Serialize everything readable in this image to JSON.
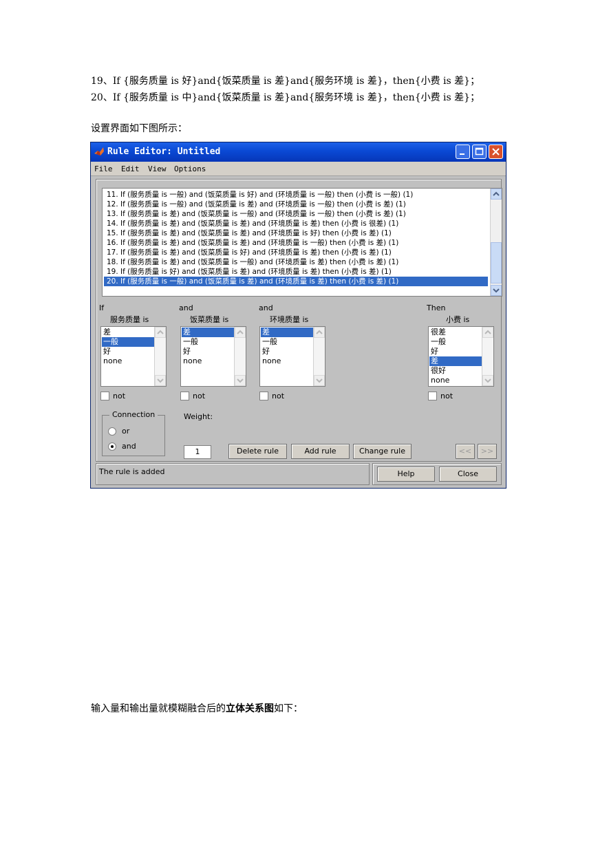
{
  "document": {
    "line1": "19、If {服务质量 is 好}and{饭菜质量 is 差}and{服务环境 is 差}，then{小费 is 差}；",
    "line2": "20、If {服务质量 is 中}and{饭菜质量 is 差}and{服务环境 is 差}，then{小费 is 差}；",
    "intro": "设置界面如下图所示：",
    "outro_prefix": "输入量和输出量就模糊融合后的",
    "outro_bold": "立体关系图",
    "outro_suffix": "如下："
  },
  "window": {
    "title": "Rule Editor: Untitled",
    "menu": [
      "File",
      "Edit",
      "View",
      "Options"
    ]
  },
  "rules": [
    "11. If (服务质量 is 一般) and (饭菜质量 is 好) and (环境质量 is 一般) then (小费 is 一般) (1)",
    "12. If (服务质量 is 一般) and (饭菜质量 is 差) and (环境质量 is 一般) then (小费 is 差) (1)",
    "13. If (服务质量 is 差) and (饭菜质量 is 一般) and (环境质量 is 一般) then (小费 is 差) (1)",
    "14. If (服务质量 is 差) and (饭菜质量 is 差) and (环境质量 is 差) then (小费 is 很差) (1)",
    "15. If (服务质量 is 差) and (饭菜质量 is 差) and (环境质量 is 好) then (小费 is 差) (1)",
    "16. If (服务质量 is 差) and (饭菜质量 is 差) and (环境质量 is 一般) then (小费 is 差) (1)",
    "17. If (服务质量 is 差) and (饭菜质量 is 好) and (环境质量 is 差) then (小费 is 差) (1)",
    "18. If (服务质量 is 差) and (饭菜质量 is 一般) and (环境质量 is 差) then (小费 is 差) (1)",
    "19. If (服务质量 is 好) and (饭菜质量 is 差) and (环境质量 is 差) then (小费 is 差) (1)",
    "20. If (服务质量 is 一般) and (饭菜质量 is 差) and (环境质量 is 差) then (小费 is 差) (1)"
  ],
  "selected_rule": 9,
  "inputs": [
    {
      "prefix": "If",
      "var": "服务质量 is",
      "items": [
        "差",
        "一般",
        "好",
        "none"
      ],
      "selected": 1,
      "not_label": "not"
    },
    {
      "prefix": "and",
      "var": "饭菜质量 is",
      "items": [
        "差",
        "一般",
        "好",
        "none"
      ],
      "selected": 0,
      "not_label": "not"
    },
    {
      "prefix": "and",
      "var": "环境质量 is",
      "items": [
        "差",
        "一般",
        "好",
        "none"
      ],
      "selected": 0,
      "not_label": "not"
    }
  ],
  "output": {
    "prefix": "Then",
    "var": "小费 is",
    "items": [
      "很差",
      "一般",
      "好",
      "差",
      "很好",
      "none"
    ],
    "selected": 3,
    "not_label": "not"
  },
  "connection": {
    "title": "Connection",
    "options": [
      "or",
      "and"
    ],
    "selected": "and"
  },
  "weight": {
    "label": "Weight:",
    "value": "1"
  },
  "buttons": {
    "delete": "Delete rule",
    "add": "Add rule",
    "change": "Change rule",
    "prev": "<<",
    "next": ">>",
    "help": "Help",
    "close": "Close"
  },
  "status": "The rule is added"
}
